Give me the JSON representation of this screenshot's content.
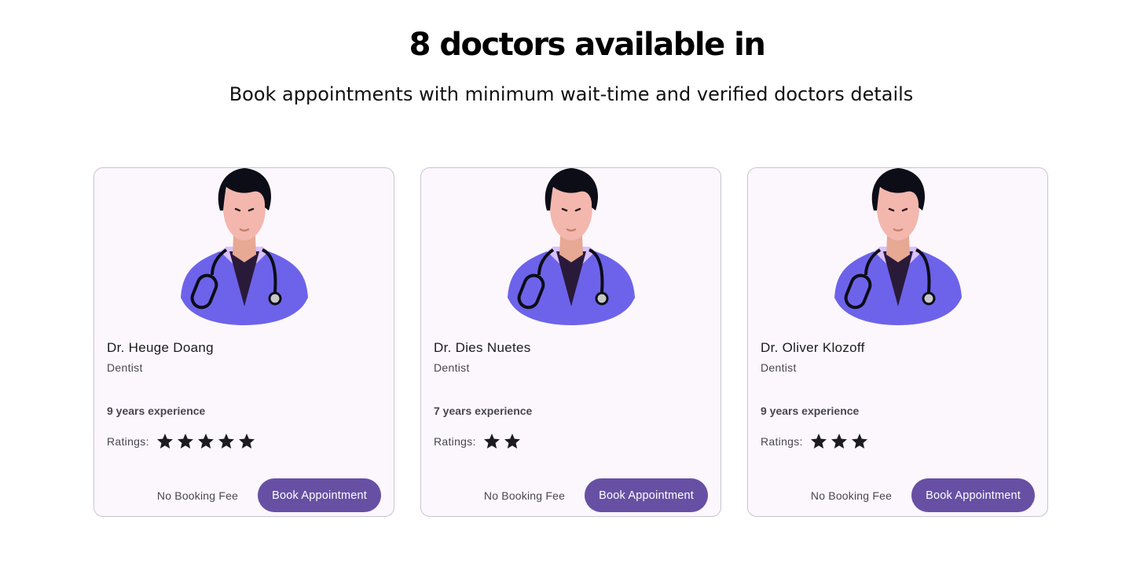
{
  "header": {
    "title": "8 doctors available in",
    "subtitle": "Book appointments with minimum wait-time and verified doctors details"
  },
  "ratings_label": "Ratings:",
  "doctors": [
    {
      "name": "Dr. Heuge Doang",
      "specialty": "Dentist",
      "experience": "9 years experience",
      "rating": 5,
      "fee_text": "No Booking Fee",
      "button_label": "Book Appointment"
    },
    {
      "name": "Dr. Dies Nuetes",
      "specialty": "Dentist",
      "experience": "7 years experience",
      "rating": 2,
      "fee_text": "No Booking Fee",
      "button_label": "Book Appointment"
    },
    {
      "name": "Dr. Oliver Klozoff",
      "specialty": "Dentist",
      "experience": "9 years experience",
      "rating": 3,
      "fee_text": "No Booking Fee",
      "button_label": "Book Appointment"
    }
  ],
  "icons": {
    "avatar": "doctor-avatar-icon",
    "star": "star-icon"
  },
  "colors": {
    "primary": "#6750a4",
    "card_bg": "#fcf7fd",
    "card_border": "#cac4d0",
    "coat": "#6d63ea",
    "star": "#1c1b1f"
  }
}
